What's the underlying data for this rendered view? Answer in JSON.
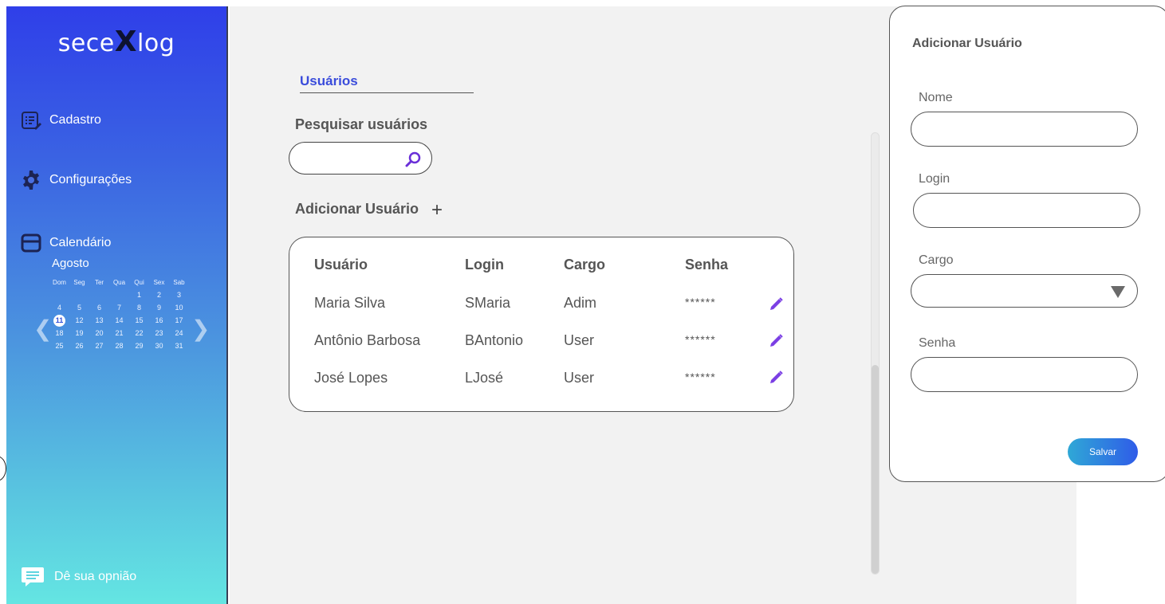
{
  "sidebar": {
    "logo": {
      "prefix": "sece",
      "mark": "X",
      "suffix": "log"
    },
    "nav": {
      "cadastro": "Cadastro",
      "configuracoes": "Configurações",
      "calendario": "Calendário"
    },
    "calendar": {
      "month": "Agosto",
      "weekdays": [
        "Dom",
        "Seg",
        "Ter",
        "Qua",
        "Qui",
        "Sex",
        "Sab"
      ],
      "weeks": [
        [
          "",
          "",
          "",
          "",
          "",
          "1",
          "2",
          "3"
        ],
        [
          "4",
          "5",
          "6",
          "7",
          "8",
          "9",
          "10"
        ],
        [
          "11",
          "12",
          "13",
          "14",
          "15",
          "16",
          "17"
        ],
        [
          "18",
          "19",
          "20",
          "21",
          "22",
          "23",
          "24"
        ],
        [
          "25",
          "26",
          "27",
          "28",
          "29",
          "30",
          "31"
        ]
      ],
      "today": "11",
      "prev_glyph": "❮",
      "next_glyph": "❯"
    },
    "feedback": "Dê sua opnião"
  },
  "main": {
    "section_title": "Usuários",
    "search_label": "Pesquisar usuários",
    "search_value": "",
    "add_user_label": "Adicionar Usuário",
    "add_user_plus": "+",
    "table": {
      "headers": [
        "Usuário",
        "Login",
        "Cargo",
        "Senha"
      ],
      "rows": [
        {
          "usuario": "Maria Silva",
          "login": "SMaria",
          "cargo": "Adim",
          "senha": "******"
        },
        {
          "usuario": "Antônio Barbosa",
          "login": "BAntonio",
          "cargo": "User",
          "senha": "******"
        },
        {
          "usuario": "José Lopes",
          "login": "LJosé",
          "cargo": "User",
          "senha": "******"
        }
      ]
    }
  },
  "panel": {
    "title": "Adicionar Usuário",
    "fields": {
      "nome": "Nome",
      "login": "Login",
      "cargo": "Cargo",
      "senha": "Senha"
    },
    "save_label": "Salvar"
  },
  "colors": {
    "accent": "#3a4cdb",
    "edit_icon": "#7b3fe4",
    "sidebar_top": "#2f3fe9",
    "sidebar_bottom": "#64e5e2"
  }
}
